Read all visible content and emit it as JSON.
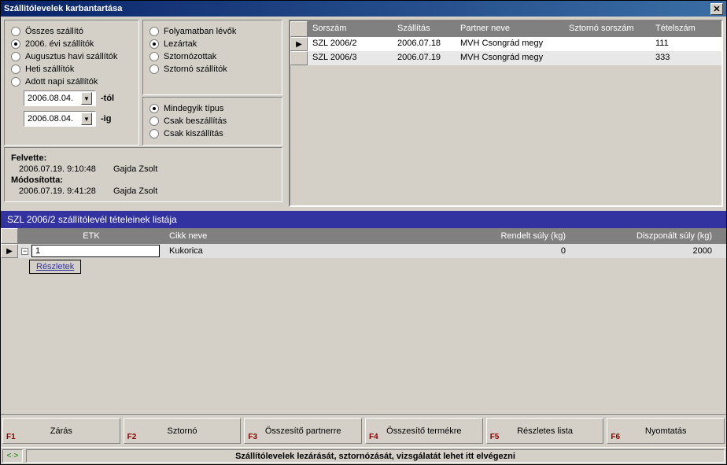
{
  "window": {
    "title": "Szállitólevelek karbantartása"
  },
  "filters": {
    "scope": [
      {
        "label": "Összes szállító",
        "selected": false
      },
      {
        "label": "2006. évi szállítók",
        "selected": true
      },
      {
        "label": "Augusztus havi szállítók",
        "selected": false
      },
      {
        "label": "Heti szállítók",
        "selected": false
      },
      {
        "label": "Adott napi szállítók",
        "selected": false
      }
    ],
    "date_from": "2006.08.04.",
    "date_to": "2006.08.04.",
    "from_suffix": "-tól",
    "to_suffix": "-ig",
    "status": [
      {
        "label": "Folyamatban lévők",
        "selected": false
      },
      {
        "label": "Lezártak",
        "selected": true
      },
      {
        "label": "Sztornózottak",
        "selected": false
      },
      {
        "label": "Sztornó szállítók",
        "selected": false
      }
    ],
    "type": [
      {
        "label": "Mindegyik típus",
        "selected": true
      },
      {
        "label": "Csak beszállítás",
        "selected": false
      },
      {
        "label": "Csak kiszállítás",
        "selected": false
      }
    ]
  },
  "audit": {
    "created_label": "Felvette:",
    "created_time": "2006.07.19. 9:10:48",
    "created_user": "Gajda Zsolt",
    "modified_label": "Módosította:",
    "modified_time": "2006.07.19. 9:41:28",
    "modified_user": "Gajda Zsolt"
  },
  "grid": {
    "headers": {
      "sorszam": "Sorszám",
      "szallitas": "Szállítás",
      "partner": "Partner neve",
      "sztorno": "Sztornó sorszám",
      "tetelszam": "Tételszám"
    },
    "rows": [
      {
        "sorszam": "SZL 2006/2",
        "szallitas": "2006.07.18",
        "partner": "MVH Csongrád megy",
        "sztorno": "",
        "tetelszam": "111",
        "selected": true
      },
      {
        "sorszam": "SZL 2006/3",
        "szallitas": "2006.07.19",
        "partner": "MVH Csongrád megy",
        "sztorno": "",
        "tetelszam": "333",
        "selected": false
      }
    ]
  },
  "section": {
    "title": "SZL 2006/2 szállítólevél tételeinek listája"
  },
  "detail": {
    "headers": {
      "etk": "ETK",
      "cikk": "Cikk neve",
      "rendelt": "Rendelt súly (kg)",
      "diszponalt": "Diszponált súly (kg)"
    },
    "rows": [
      {
        "etk": "1",
        "cikk": "Kukorica",
        "rendelt": "0",
        "diszponalt": "2000"
      }
    ],
    "details_btn": "Részletek"
  },
  "fkeys": [
    {
      "key": "F1",
      "label": "Zárás"
    },
    {
      "key": "F2",
      "label": "Sztornó"
    },
    {
      "key": "F3",
      "label": "Összesítő partnerre"
    },
    {
      "key": "F4",
      "label": "Összesítő termékre"
    },
    {
      "key": "F5",
      "label": "Részletes lista"
    },
    {
      "key": "F6",
      "label": "Nyomtatás"
    }
  ],
  "status": {
    "corner": "<·>",
    "text": "Szállítólevelek lezárását, sztornózását, vizsgálatát lehet itt elvégezni"
  }
}
